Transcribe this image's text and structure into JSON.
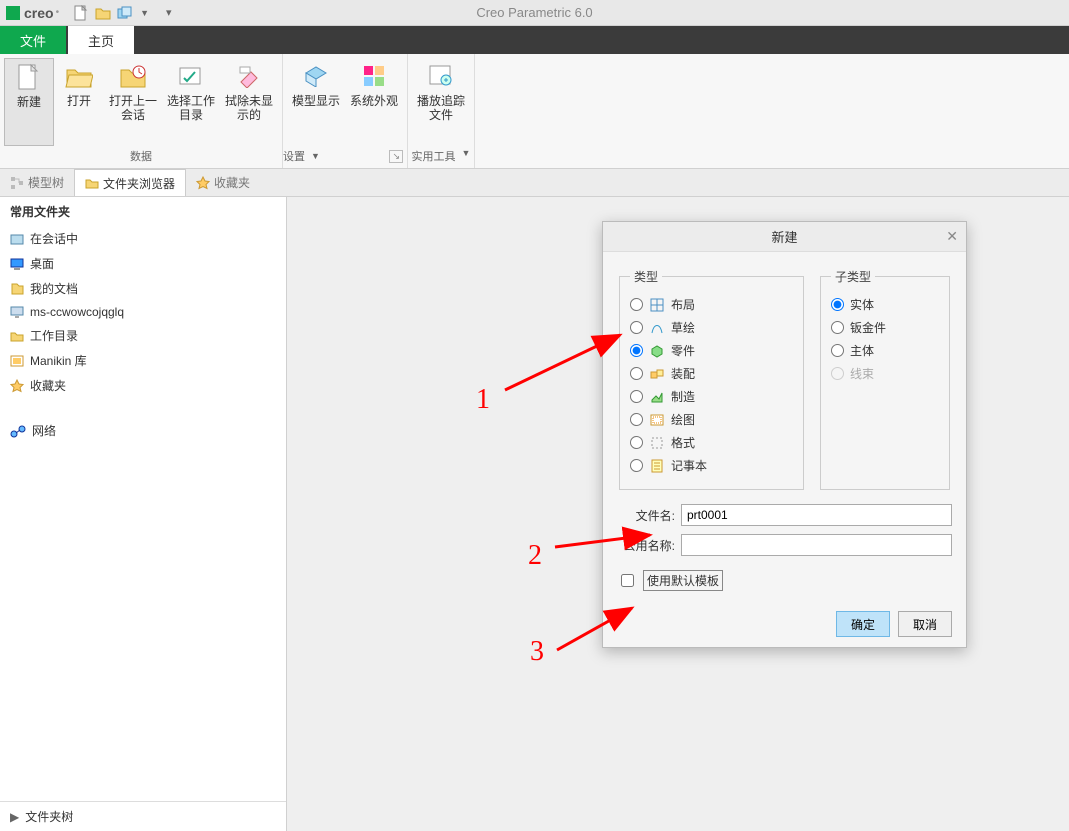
{
  "app": {
    "brand": "creo",
    "title": "Creo Parametric 6.0"
  },
  "tabs": {
    "file": "文件",
    "home": "主页"
  },
  "ribbon": {
    "group_data": "数据",
    "group_settings": "设置",
    "group_util": "实用工具",
    "new": "新建",
    "open": "打开",
    "last_session": "打开上一会话",
    "select_wd": "选择工作目录",
    "erase": "拭除未显示的",
    "model_disp": "模型显示",
    "sys_appear": "系统外观",
    "play_trail": "播放追踪文件"
  },
  "navtabs": {
    "modeltree": "模型树",
    "folder": "文件夹浏览器",
    "fav": "收藏夹"
  },
  "sidebar": {
    "title": "常用文件夹",
    "items": [
      "在会话中",
      "桌面",
      "我的文档",
      "ms-ccwowcojqglq",
      "工作目录",
      "Manikin 库",
      "收藏夹"
    ],
    "network": "网络",
    "footer": "文件夹树"
  },
  "dialog": {
    "title": "新建",
    "type_legend": "类型",
    "sub_legend": "子类型",
    "types": [
      "布局",
      "草绘",
      "零件",
      "装配",
      "制造",
      "绘图",
      "格式",
      "记事本"
    ],
    "subtypes": [
      "实体",
      "钣金件",
      "主体",
      "线束"
    ],
    "filename_label": "文件名:",
    "commonname_label": "公用名称:",
    "filename_value": "prt0001",
    "commonname_value": "",
    "use_template": "使用默认模板",
    "ok": "确定",
    "cancel": "取消"
  },
  "annotations": {
    "a1": "1",
    "a2": "2",
    "a3": "3"
  }
}
